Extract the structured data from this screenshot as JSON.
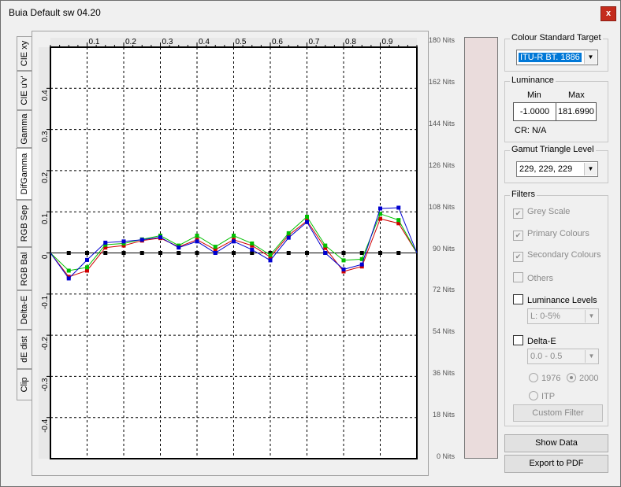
{
  "window": {
    "title": "Buia Default sw 04.20",
    "close_glyph": "x"
  },
  "tabs": [
    {
      "label": "CIE xy",
      "active": false
    },
    {
      "label": "CIE u'v'",
      "active": false
    },
    {
      "label": "Gamma",
      "active": false
    },
    {
      "label": "DifGamma",
      "active": true
    },
    {
      "label": "RGB Sep",
      "active": false
    },
    {
      "label": "RGB Bal",
      "active": false
    },
    {
      "label": "Delta-E",
      "active": false
    },
    {
      "label": "dE dist",
      "active": false
    },
    {
      "label": "Clip",
      "active": false
    }
  ],
  "chart_data": {
    "type": "line",
    "x_ticks": [
      "0.1",
      "0.2",
      "0.3",
      "0.4",
      "0.5",
      "0.6",
      "0.7",
      "0.8",
      "0.9"
    ],
    "y_ticks": [
      "0.4",
      "0.3",
      "0.2",
      "0.1",
      "0",
      "-0.1",
      "-0.2",
      "-0.3",
      "-0.4"
    ],
    "xlim": [
      0,
      1
    ],
    "ylim": [
      -0.5,
      0.5
    ],
    "grid": true,
    "x": [
      0,
      0.05,
      0.1,
      0.15,
      0.2,
      0.25,
      0.3,
      0.35,
      0.4,
      0.45,
      0.5,
      0.55,
      0.6,
      0.65,
      0.7,
      0.75,
      0.8,
      0.85,
      0.9,
      0.95,
      1.0
    ],
    "series": [
      {
        "color": "#000000",
        "values": [
          0,
          0,
          0,
          0,
          0,
          0,
          0,
          0,
          0,
          0,
          0,
          0,
          0,
          0,
          0,
          0,
          0,
          0,
          0,
          0,
          0
        ]
      },
      {
        "color": "#d00000",
        "values": [
          0,
          -0.058,
          -0.043,
          0.013,
          0.018,
          0.03,
          0.036,
          0.015,
          0.032,
          0.008,
          0.032,
          0.018,
          -0.01,
          0.043,
          0.078,
          0.012,
          -0.045,
          -0.033,
          0.083,
          0.072,
          0
        ]
      },
      {
        "color": "#00c000",
        "values": [
          0,
          -0.043,
          -0.035,
          0.02,
          0.023,
          0.033,
          0.042,
          0.018,
          0.042,
          0.015,
          0.042,
          0.023,
          -0.005,
          0.048,
          0.088,
          0.018,
          -0.018,
          -0.015,
          0.095,
          0.08,
          0
        ]
      },
      {
        "color": "#0000d0",
        "values": [
          0,
          -0.062,
          -0.017,
          0.025,
          0.028,
          0.032,
          0.038,
          0.013,
          0.028,
          0,
          0.028,
          0.008,
          -0.018,
          0.037,
          0.075,
          0,
          -0.04,
          -0.028,
          0.108,
          0.11,
          0
        ]
      }
    ]
  },
  "luminance_bar": {
    "labels": [
      "180 Nits",
      "162 Nits",
      "144 Nits",
      "126 Nits",
      "108 Nits",
      "90 Nits",
      "72 Nits",
      "54 Nits",
      "36 Nits",
      "18 Nits",
      "0 Nits"
    ],
    "bar_color": "#eadcdc"
  },
  "colour_standard": {
    "title": "Colour Standard Target",
    "value": "ITU-R BT. 1886"
  },
  "luminance": {
    "title": "Luminance",
    "min_label": "Min",
    "max_label": "Max",
    "min_value": "-1.0000",
    "max_value": "181.6990",
    "cr_text": "CR: N/A"
  },
  "gamut": {
    "title": "Gamut Triangle Level",
    "value": "229, 229, 229"
  },
  "filters": {
    "title": "Filters",
    "grey_scale": "Grey Scale",
    "primary": "Primary Colours",
    "secondary": "Secondary Colours",
    "others": "Others",
    "lum_levels": "Luminance Levels",
    "lum_select": "L:   0-5%",
    "delta_e": "Delta-E",
    "delta_select": "0.0 - 0.5",
    "r1976": "1976",
    "r2000": "2000",
    "itp": "ITP",
    "custom_filter": "Custom Filter",
    "check_glyph": "✔"
  },
  "buttons": {
    "show_data": "Show Data",
    "export_pdf": "Export to PDF"
  }
}
